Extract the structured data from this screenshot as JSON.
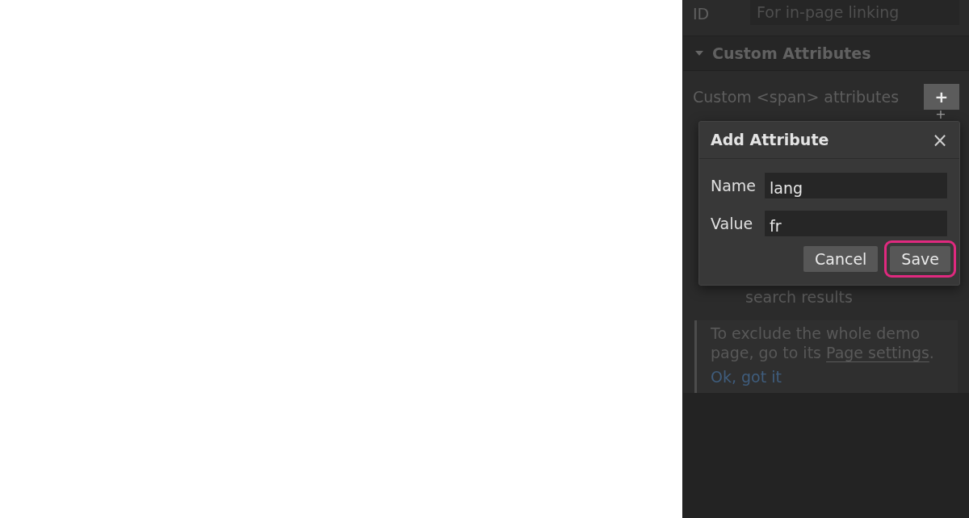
{
  "panel": {
    "id_field": {
      "label": "ID",
      "placeholder": "For in-page linking"
    },
    "section": {
      "title": "Custom Attributes",
      "expanded": true
    },
    "attributes_label": "Custom <span> attributes",
    "add_button": "+",
    "covered_text": "search results",
    "notice": {
      "text_before": "To exclude the whole demo page, go to its ",
      "link": "Page settings",
      "text_after": ".",
      "dismiss": "Ok, got it"
    }
  },
  "dialog": {
    "title": "Add Attribute",
    "close": "×",
    "fields": [
      {
        "label": "Name",
        "value": "lang"
      },
      {
        "label": "Value",
        "value": "fr"
      }
    ],
    "buttons": [
      {
        "label": "Cancel",
        "highlighted": false
      },
      {
        "label": "Save",
        "highlighted": true
      }
    ]
  }
}
